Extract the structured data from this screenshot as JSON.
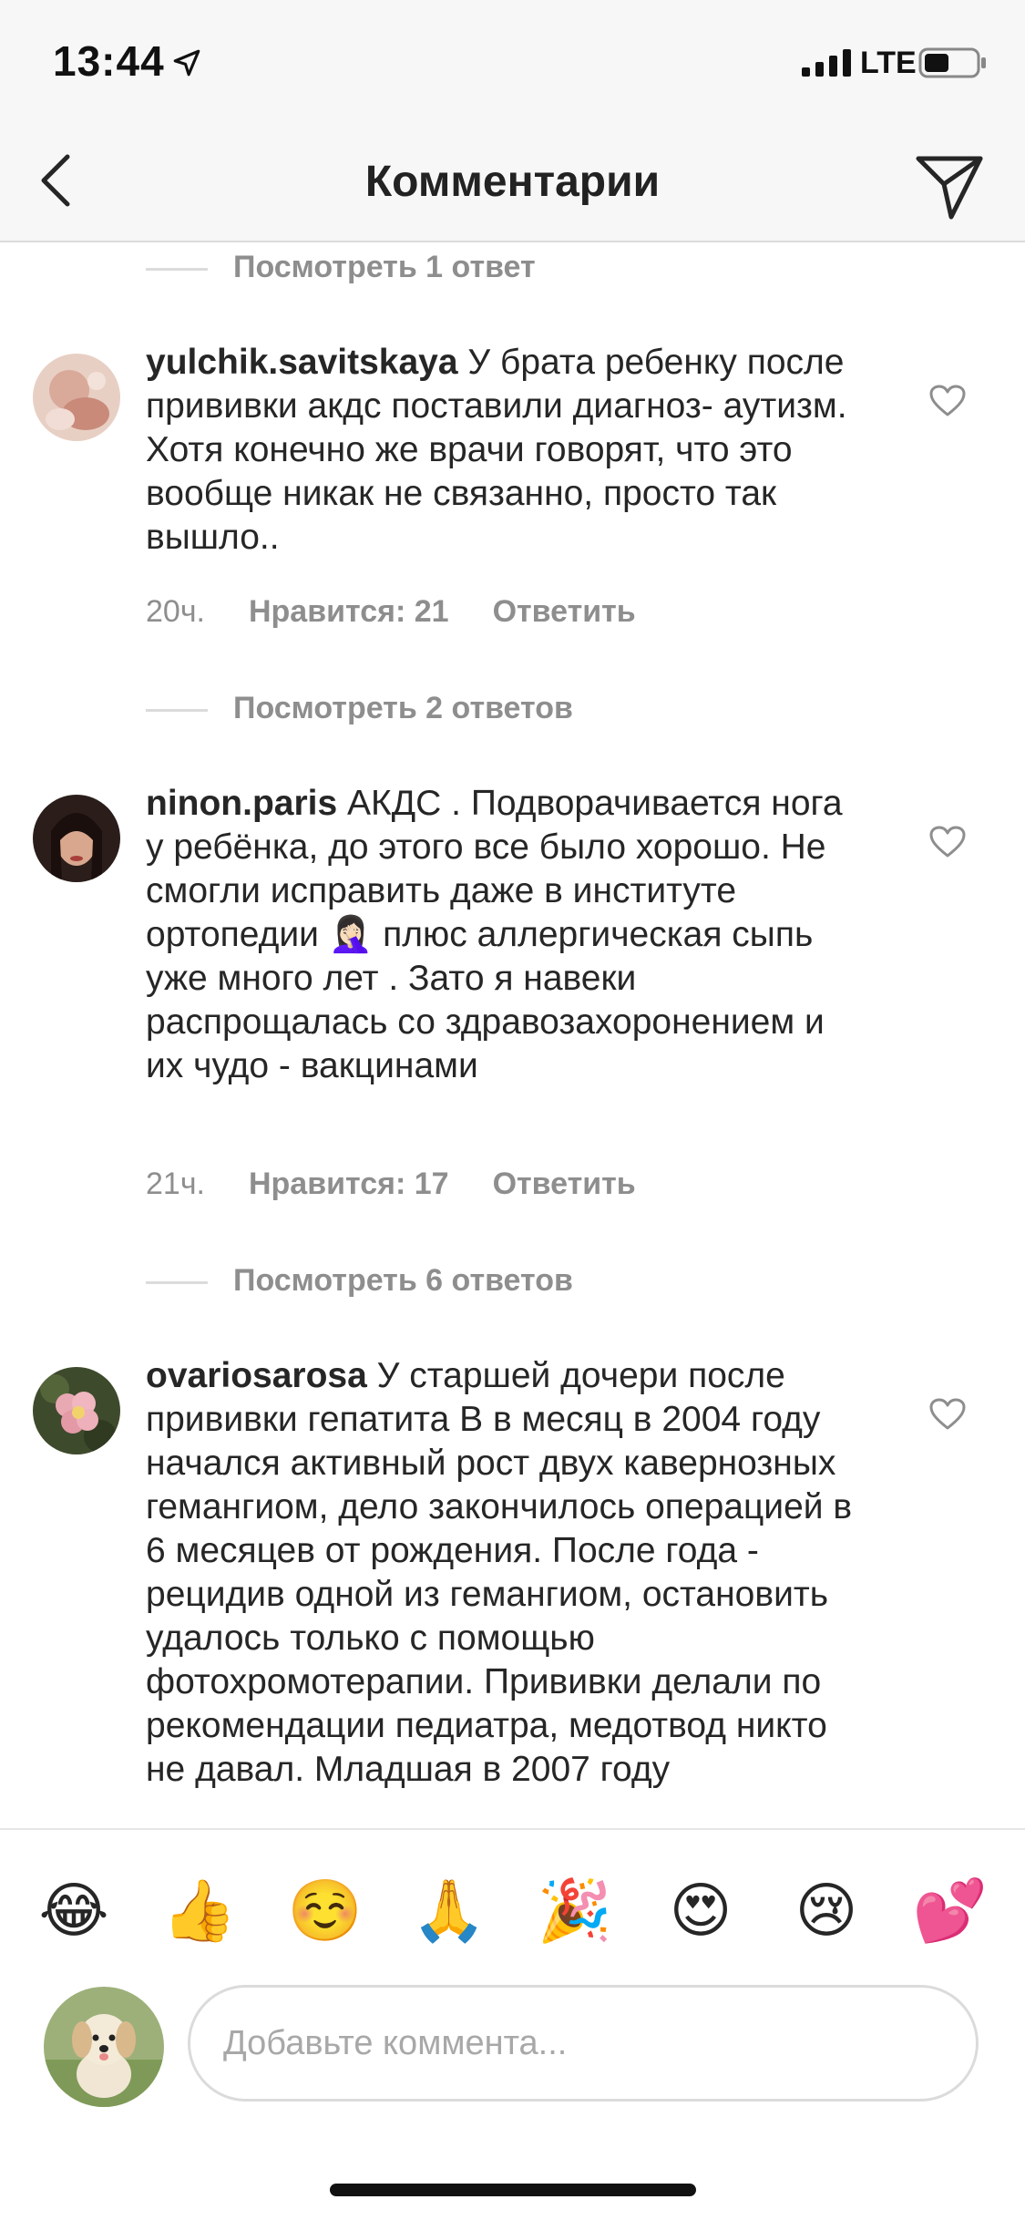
{
  "status_bar": {
    "time": "13:44",
    "network": "LTE"
  },
  "header": {
    "title": "Комментарии"
  },
  "comments": [
    {
      "view_replies": "Посмотреть 1 ответ"
    },
    {
      "username": "yulchik.savitskaya",
      "text": " У брата ребенку после прививки акдс поставили диагноз- аутизм. Хотя конечно же врачи говорят, что это вообще никак не связанно, просто так вышло..",
      "time": "20ч.",
      "likes": "Нравится: 21",
      "reply": "Ответить",
      "view_replies": "Посмотреть 2 ответов"
    },
    {
      "username": "ninon.paris",
      "text_before_emoji": " АКДС . Подворачивается нога у ребёнка, до этого все было хорошо. Не смогли исправить даже в институте ортопедии ",
      "emoji": "🤦🏻‍♀️",
      "text_after_emoji": " плюс аллергическая сыпь уже много лет . Зато я навеки распрощалась со здравозахоронением и их чудо - вакцинами",
      "time": "21ч.",
      "likes": "Нравится: 17",
      "reply": "Ответить",
      "view_replies": "Посмотреть 6 ответов"
    },
    {
      "username": "ovariosarosa",
      "text": " У старшей дочери после прививки гепатита В в месяц в 2004 году начался активный рост двух кавернозных гемангиом, дело закончилось операцией в 6 месяцев от рождения. После года - рецидив одной из гемангиом, остановить удалось только с помощью фотохромотерапии. Прививки делали по рекомендации педиатра, медотвод никто не давал. Младшая в 2007 году"
    }
  ],
  "emoji_bar": [
    "😂",
    "👍",
    "☺️",
    "🙏",
    "🎉",
    "😍",
    "😢",
    "💕"
  ],
  "input": {
    "placeholder": "Добавьте коммента..."
  },
  "colors": {
    "text": "#262626",
    "secondary": "#8e8e8e",
    "bar_background": "#f7f7f7"
  }
}
